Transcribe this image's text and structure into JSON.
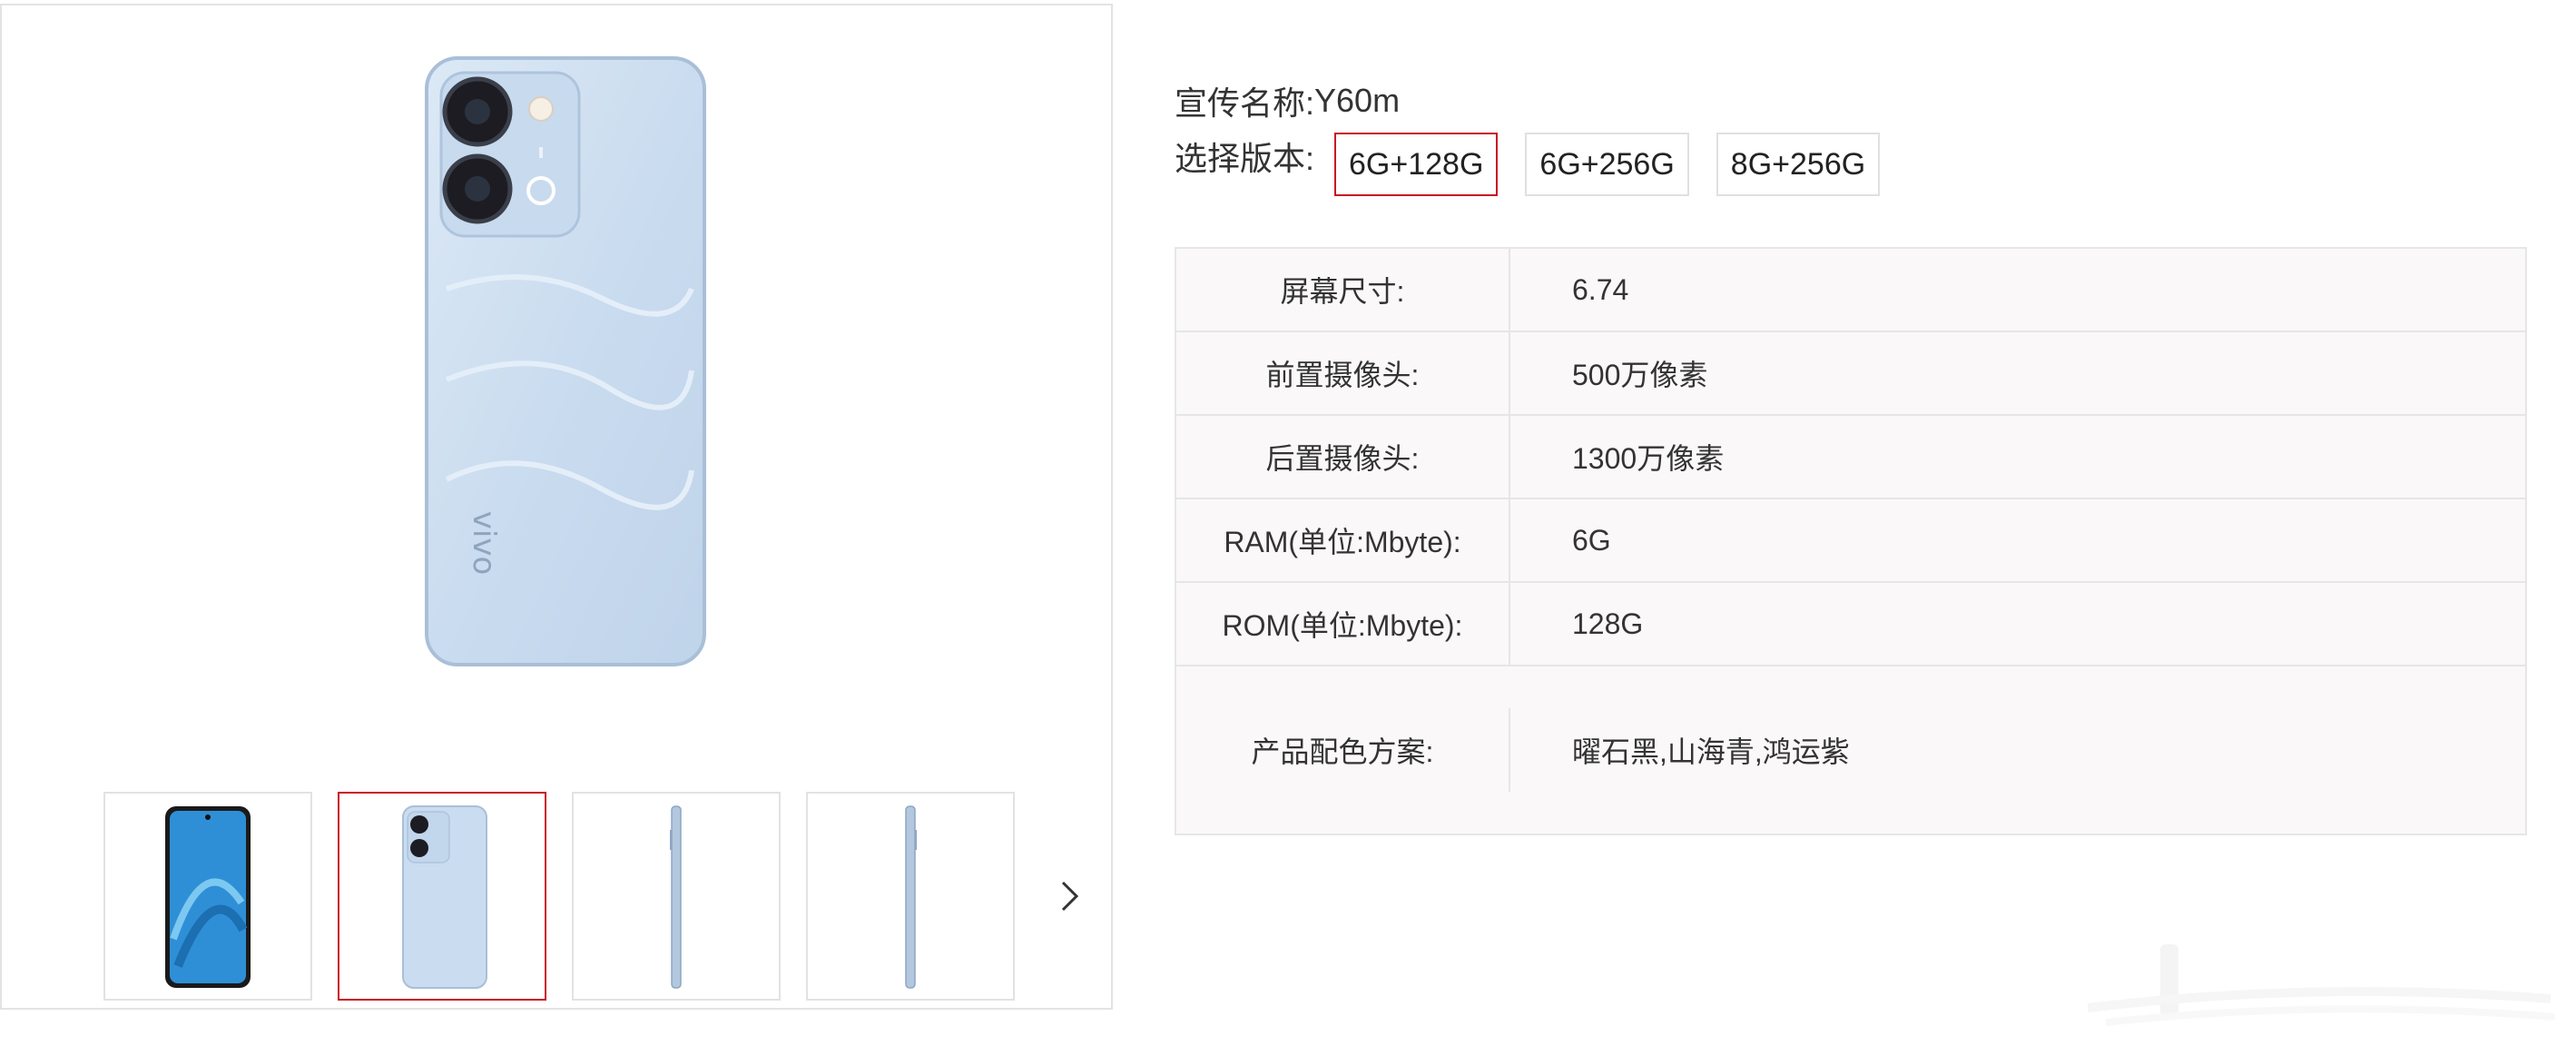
{
  "product": {
    "promo_label": "宣传名称:",
    "promo_name": "Y60m",
    "version_label": "选择版本:",
    "versions": [
      {
        "label": "6G+128G",
        "selected": true
      },
      {
        "label": "6G+256G",
        "selected": false
      },
      {
        "label": "8G+256G",
        "selected": false
      }
    ]
  },
  "specs": [
    {
      "key": "屏幕尺寸:",
      "value": "6.74"
    },
    {
      "key": "前置摄像头:",
      "value": "500万像素"
    },
    {
      "key": "后置摄像头:",
      "value": "1300万像素"
    },
    {
      "key": "RAM(单位:Mbyte):",
      "value": "6G"
    },
    {
      "key": "ROM(单位:Mbyte):",
      "value": "128G"
    },
    {
      "key": "产品配色方案:",
      "value": "曜石黑,山海青,鸿运紫"
    }
  ],
  "gallery": {
    "main_image": "phone-back-image",
    "thumbnails": [
      "phone-front-thumbnail",
      "phone-back-thumbnail",
      "phone-side-thumbnail",
      "phone-side-thumbnail"
    ],
    "selected_index": 1,
    "next_icon": "chevron-right-icon"
  },
  "colors": {
    "accent": "#c81623",
    "border": "#e3e3e3",
    "phone_body": "#cfe0f2"
  }
}
